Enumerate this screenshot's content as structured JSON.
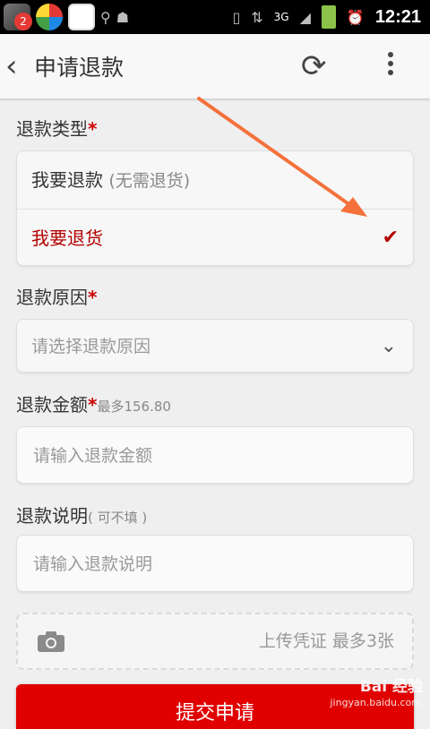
{
  "statusbar": {
    "notification_count": "2",
    "time": "12:21",
    "network": "3G",
    "icons": [
      "app-notification-icon",
      "pinwheel-app-icon",
      "store-app-icon",
      "usb-icon",
      "android-debug-icon",
      "vibrate-icon",
      "data-hplus-icon",
      "signal-icon",
      "battery-icon",
      "alarm-icon"
    ]
  },
  "topbar": {
    "title": "申请退款",
    "icons": [
      "back-icon",
      "refresh-icon",
      "overflow-menu-icon"
    ]
  },
  "refund_type": {
    "label": "退款类型",
    "required_mark": "*",
    "options": [
      {
        "label": "我要退款",
        "note": "(无需退货)",
        "selected": false
      },
      {
        "label": "我要退货",
        "note": "",
        "selected": true
      }
    ],
    "selected_color": "#b30000"
  },
  "refund_reason": {
    "label": "退款原因",
    "required_mark": "*",
    "placeholder": "请选择退款原因"
  },
  "refund_amount": {
    "label": "退款金额",
    "required_mark": "*",
    "max_hint": "最多156.80",
    "placeholder": "请输入退款金额"
  },
  "refund_note": {
    "label": "退款说明",
    "optional_hint": "( 可不填 )",
    "placeholder": "请输入退款说明"
  },
  "upload": {
    "label": "上传凭证 最多3张"
  },
  "submit": {
    "label": "提交申请",
    "color": "#e00000"
  },
  "annotation_arrow_color": "#f4713b",
  "watermark": {
    "text": "Bai 经验",
    "sub": "jingyan.baidu.com"
  }
}
